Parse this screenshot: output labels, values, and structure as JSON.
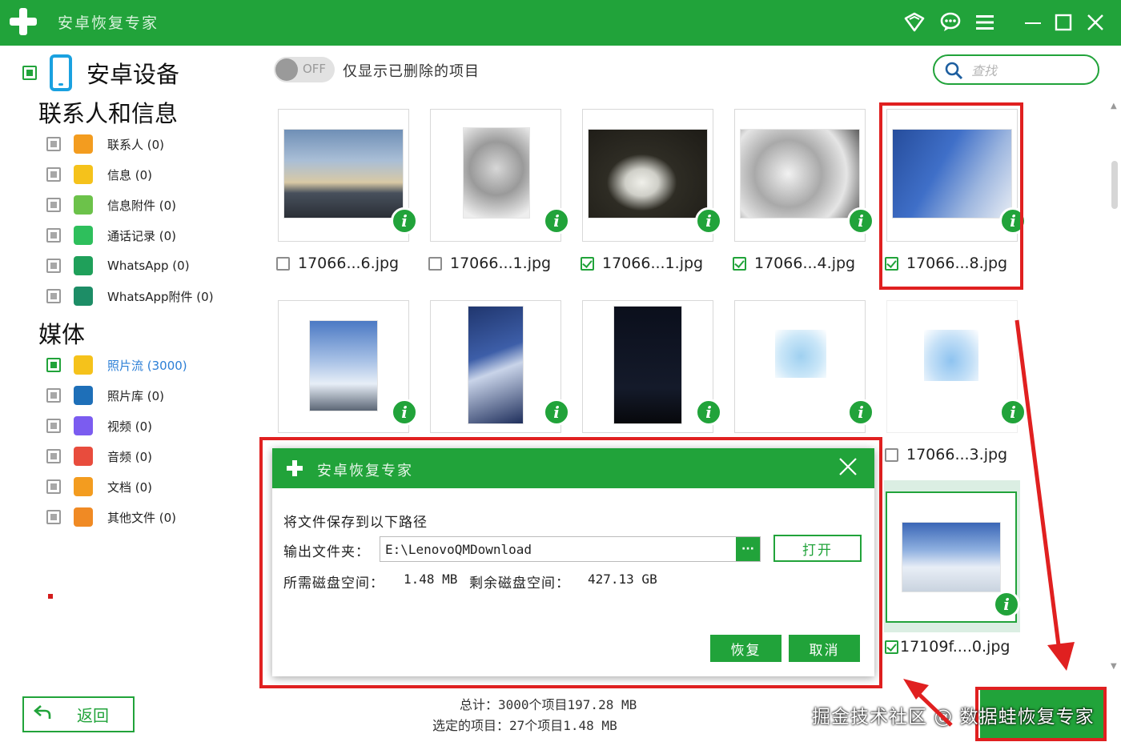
{
  "app": {
    "title": "安卓恢复专家"
  },
  "titlebar_icons": [
    "wifi-icon",
    "chat-icon",
    "menu-icon",
    "minimize-icon",
    "maximize-icon",
    "close-icon"
  ],
  "sidebar": {
    "device_label": "安卓设备",
    "contacts_section": "联系人和信息",
    "contact_items": [
      {
        "label": "联系人 (0)",
        "icon": "contact-icon",
        "color": "#f39c1f"
      },
      {
        "label": "信息 (0)",
        "icon": "message-icon",
        "color": "#f5c21b"
      },
      {
        "label": "信息附件 (0)",
        "icon": "attachment-icon",
        "color": "#6cc24a"
      },
      {
        "label": "通话记录 (0)",
        "icon": "phone-call-icon",
        "color": "#2ebf5c"
      },
      {
        "label": "WhatsApp (0)",
        "icon": "whatsapp-icon",
        "color": "#1fa05a"
      },
      {
        "label": "WhatsApp附件 (0)",
        "icon": "whatsapp-attachment-icon",
        "color": "#1d8d66"
      }
    ],
    "media_section": "媒体",
    "media_items": [
      {
        "label": "照片流 (3000)",
        "icon": "star-photo-icon",
        "color": "#f5c21b",
        "active": true
      },
      {
        "label": "照片库 (0)",
        "icon": "gallery-icon",
        "color": "#1e6fb8"
      },
      {
        "label": "视频 (0)",
        "icon": "video-icon",
        "color": "#7b5cf0"
      },
      {
        "label": "音频 (0)",
        "icon": "music-icon",
        "color": "#e84c3d"
      },
      {
        "label": "文档 (0)",
        "icon": "folder-icon",
        "color": "#f39c1f"
      },
      {
        "label": "其他文件 (0)",
        "icon": "file-icon",
        "color": "#f08a24"
      }
    ],
    "back_label": "返回"
  },
  "toolbar": {
    "toggle_state": "OFF",
    "filter_label": "仅显示已删除的项目",
    "search_placeholder": "查找"
  },
  "grid": {
    "files": [
      {
        "name": "17066...6.jpg",
        "checked": false
      },
      {
        "name": "17066...1.jpg",
        "checked": false
      },
      {
        "name": "17066...1.jpg",
        "checked": true
      },
      {
        "name": "17066...4.jpg",
        "checked": true
      },
      {
        "name": "17066...8.jpg",
        "checked": true
      },
      {
        "name": "17066...3.jpg",
        "checked": false
      },
      {
        "name": "17109f....0.jpg",
        "checked": true
      }
    ],
    "info_glyph": "i"
  },
  "dialog": {
    "title": "安卓恢复专家",
    "heading": "将文件保存到以下路径",
    "output_label": "输出文件夹：",
    "output_path": "E:\\LenovoQMDownload",
    "browse_label": "···",
    "open_label": "打开",
    "required_label": "所需磁盘空间：",
    "required_value": "1.48 MB",
    "remaining_label": "剩余磁盘空间：",
    "remaining_value": "427.13 GB",
    "recover_label": "恢复",
    "cancel_label": "取消"
  },
  "footer": {
    "total": "总计：3000个项目197.28 MB",
    "selected": "选定的项目：27个项目1.48 MB"
  },
  "watermark": "掘金技术社区 @ 数据蛙恢复专家",
  "colors": {
    "brand": "#21a33a",
    "highlight": "#e02020",
    "link": "#2c7fd6"
  }
}
